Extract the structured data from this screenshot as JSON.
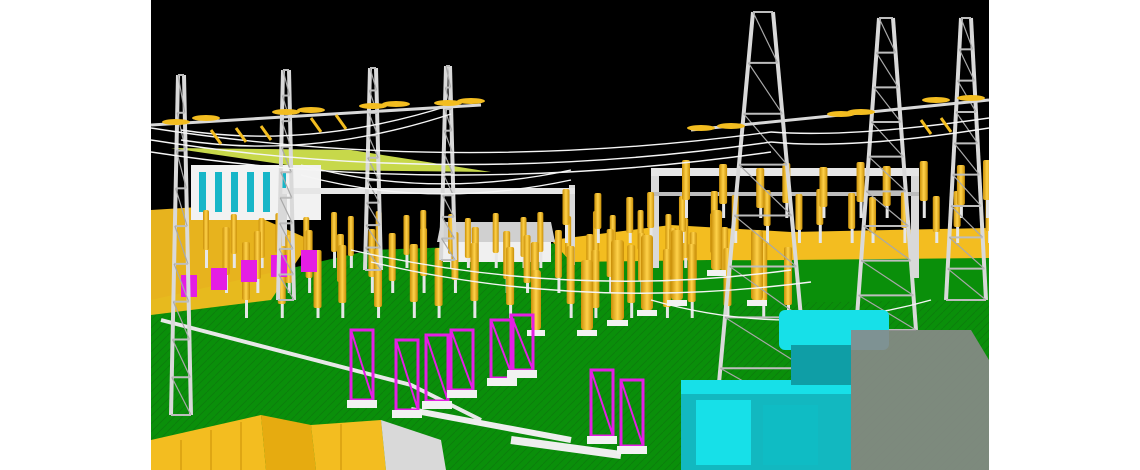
{
  "scene": {
    "subject": "substation-3d-render",
    "palette": {
      "sky": "#000000",
      "ground": "#0a8f0a",
      "ground_dark": "#067306",
      "insulator": "#f2b81d",
      "insulator_shade": "#c98f08",
      "steel": "#d9d9d9",
      "steel_shade": "#9a9a9a",
      "magenta": "#e41ee4",
      "cyan": "#17e0e8",
      "roof_yellow": "#f3bd20",
      "building_white": "#f2f2f2"
    }
  }
}
